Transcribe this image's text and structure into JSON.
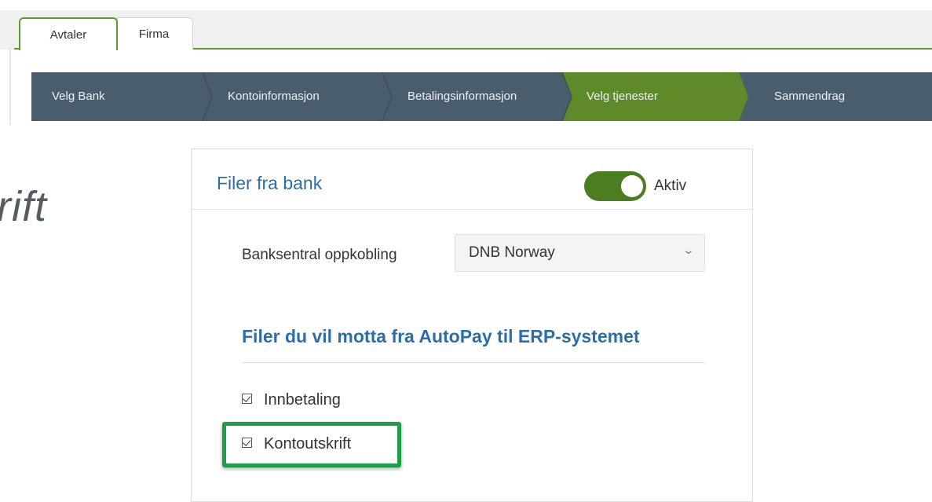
{
  "tabs": [
    {
      "label": "Avtaler",
      "active": true
    },
    {
      "label": "Firma",
      "active": false
    }
  ],
  "wizard": {
    "steps": [
      {
        "label": "Velg Bank",
        "active": false
      },
      {
        "label": "Kontoinformasjon",
        "active": false
      },
      {
        "label": "Betalingsinformasjon",
        "active": false
      },
      {
        "label": "Velg tjenester",
        "active": true
      },
      {
        "label": "Sammendrag",
        "active": false
      }
    ],
    "colors": {
      "inactive": "#4a5d6d",
      "active": "#5e8a2a"
    }
  },
  "page": {
    "heading_fragment": "rift"
  },
  "panel": {
    "title": "Filer fra bank",
    "toggle": {
      "label": "Aktiv",
      "on": true
    },
    "bank_field": {
      "label": "Banksentral oppkobling",
      "value": "DNB Norway"
    },
    "section_title": "Filer du vil motta fra AutoPay til ERP-systemet",
    "files": [
      {
        "label": "Innbetaling",
        "checked": true
      },
      {
        "label": "Kontoutskrift",
        "checked": true,
        "highlighted": true
      }
    ]
  },
  "icons": {
    "dropdown": "chevron-down-icon",
    "checkbox": "checkbox-checked-icon"
  }
}
